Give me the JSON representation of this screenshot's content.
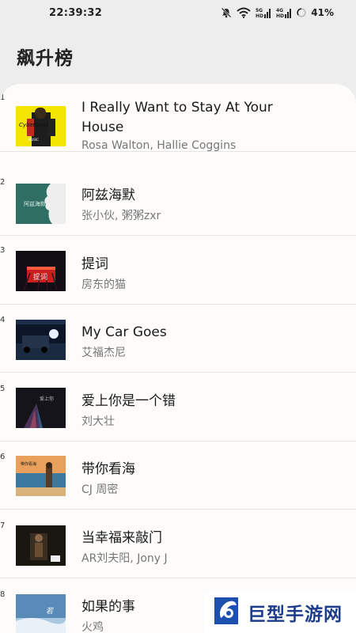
{
  "status": {
    "time": "22:39:32",
    "signal1_label": "5G\nHD",
    "signal2_label": "4G\nHD",
    "battery": "41%"
  },
  "header": {
    "title": "飙升榜"
  },
  "songs": [
    {
      "rank": "1",
      "title": "I Really Want to Stay At Your House",
      "artist": "Rosa Walton, Hallie Coggins"
    },
    {
      "rank": "2",
      "title": "阿兹海默",
      "artist": "张小伙, 粥粥zxr"
    },
    {
      "rank": "3",
      "title": "提词",
      "artist": "房东的猫"
    },
    {
      "rank": "4",
      "title": "My Car Goes",
      "artist": "艾福杰尼"
    },
    {
      "rank": "5",
      "title": "爱上你是一个错",
      "artist": "刘大壮"
    },
    {
      "rank": "6",
      "title": "带你看海",
      "artist": "CJ 周密"
    },
    {
      "rank": "7",
      "title": "当幸福来敲门",
      "artist": "AR刘夫阳, Jony J"
    },
    {
      "rank": "8",
      "title": "如果的事",
      "artist": "火鸡"
    }
  ],
  "watermark": {
    "text": "巨型手游网"
  }
}
